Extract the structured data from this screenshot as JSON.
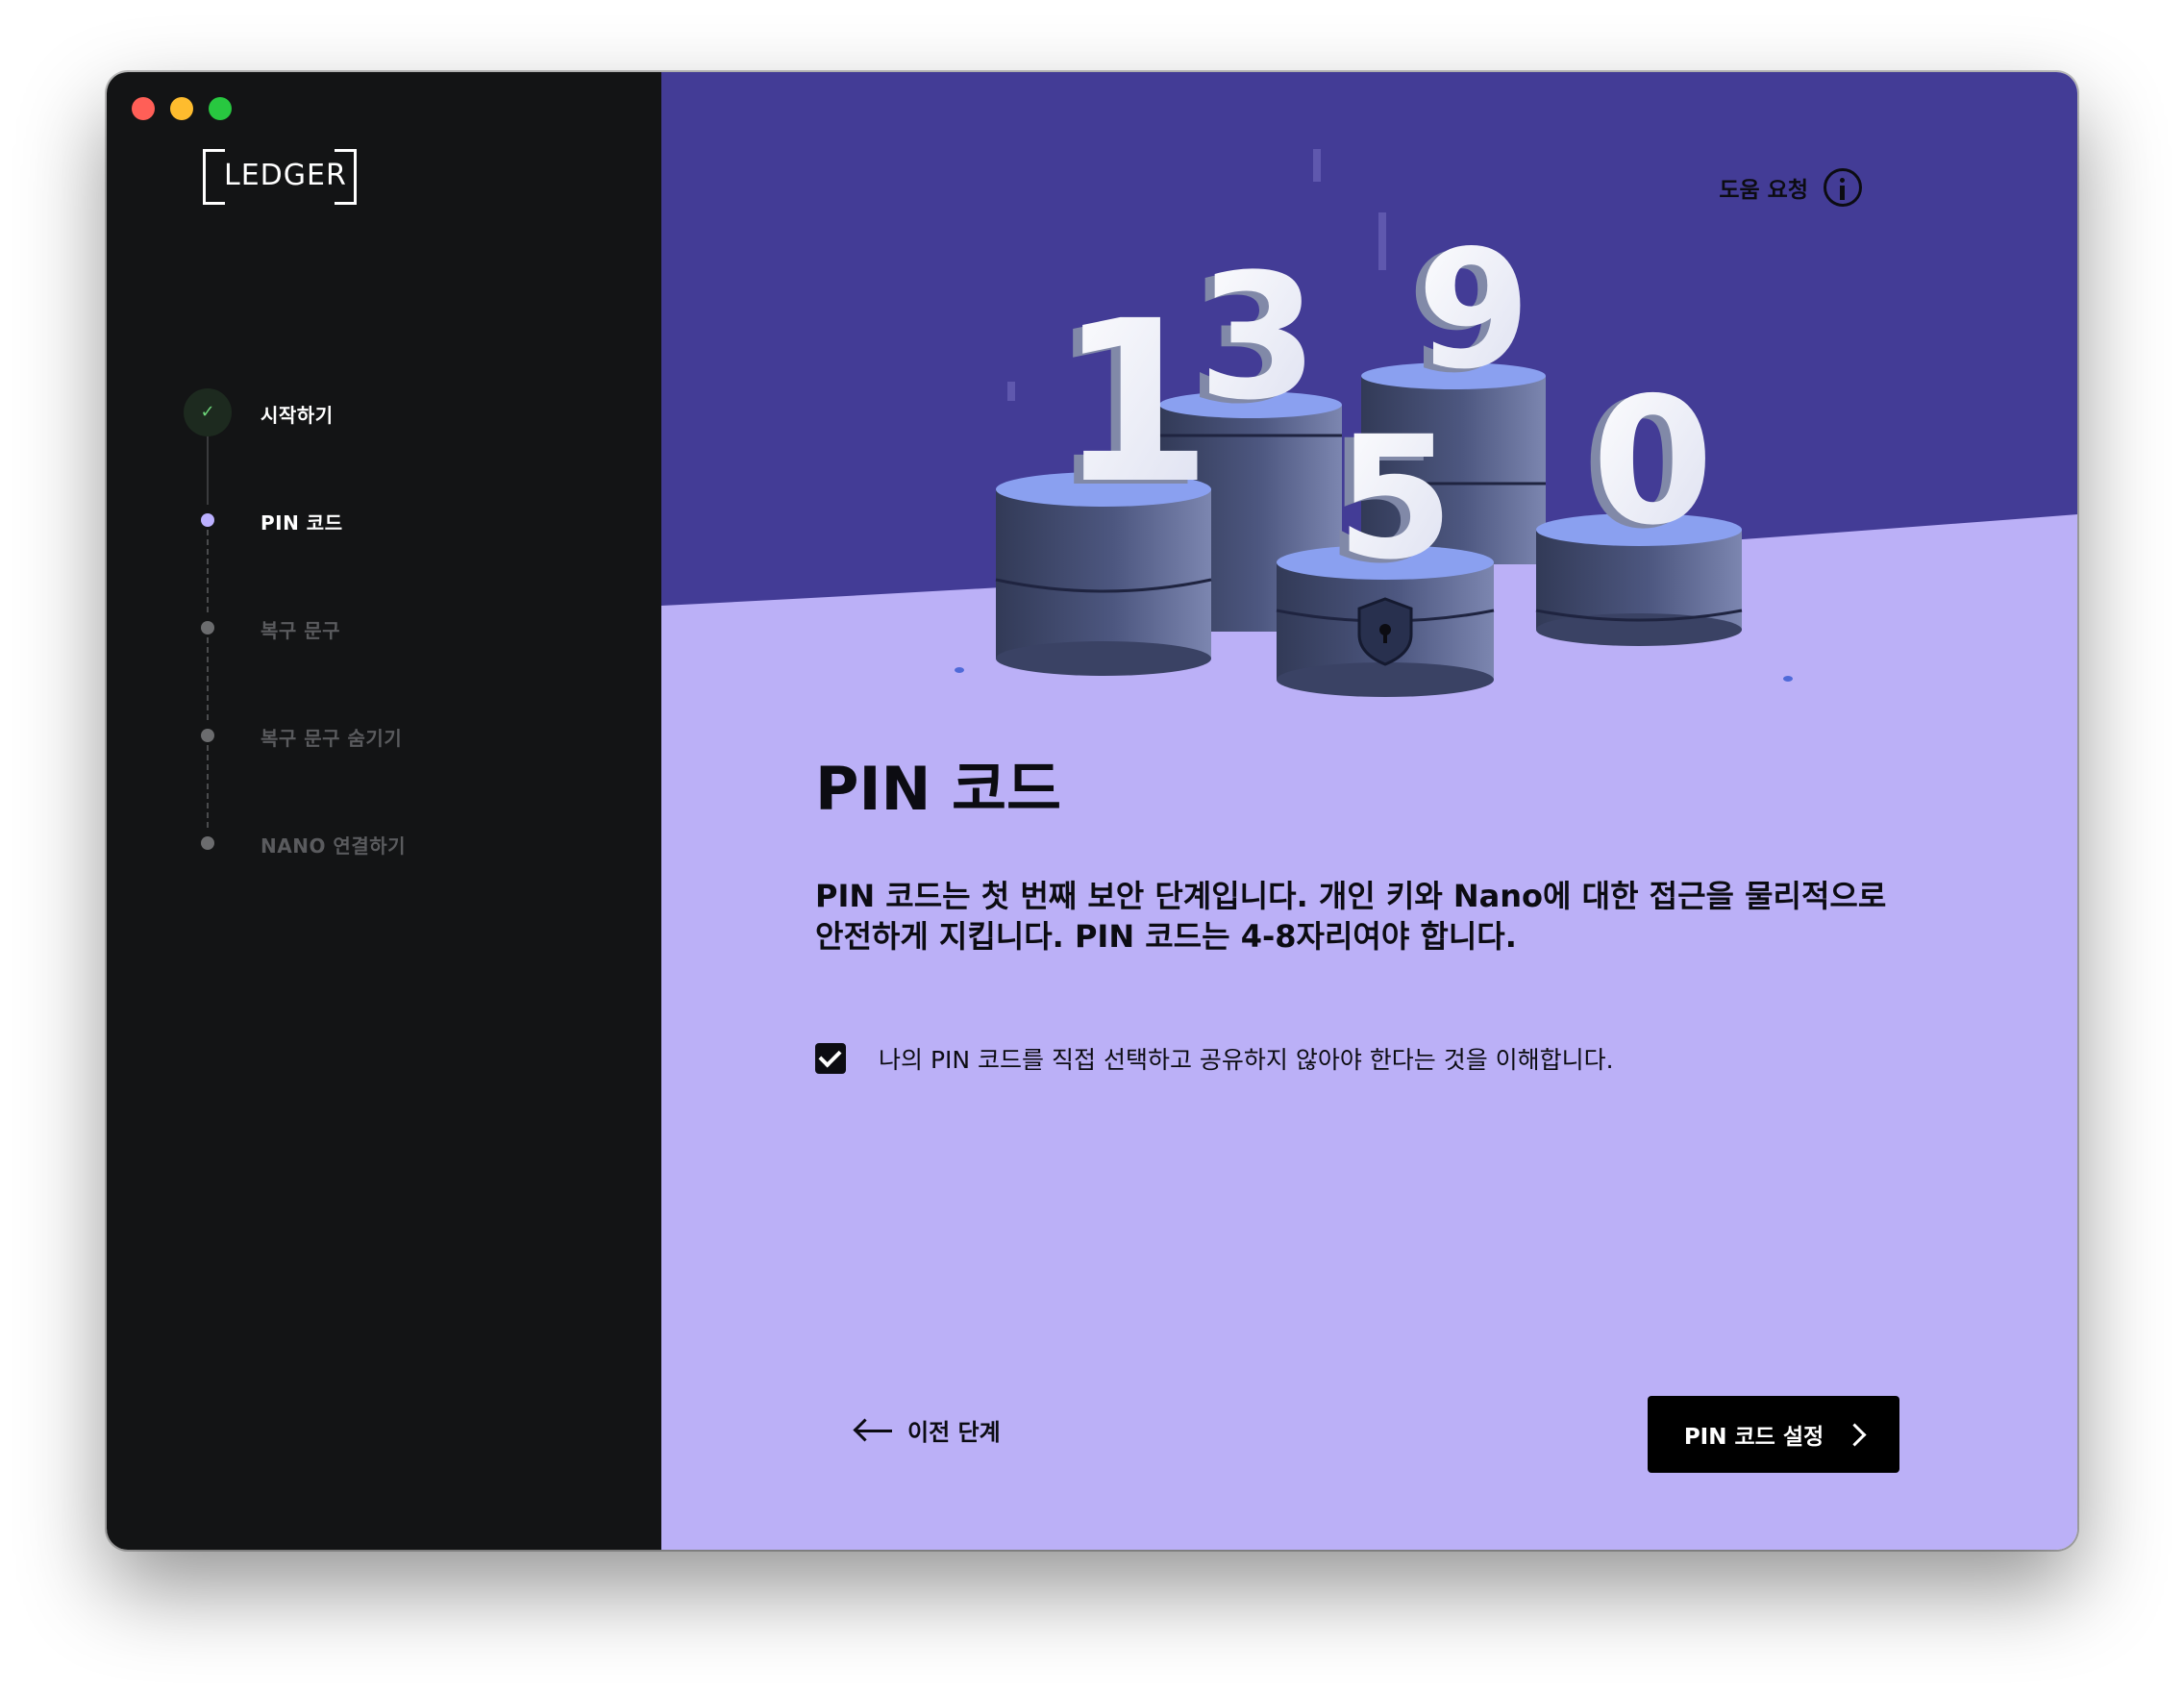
{
  "app": {
    "logo_text": "LEDGER"
  },
  "sidebar": {
    "steps": [
      {
        "label": "시작하기",
        "state": "done"
      },
      {
        "label": "PIN 코드",
        "state": "active"
      },
      {
        "label": "복구 문구",
        "state": "pending"
      },
      {
        "label": "복구 문구 숨기기",
        "state": "pending"
      },
      {
        "label": "NANO 연결하기",
        "state": "pending"
      }
    ]
  },
  "header": {
    "help_label": "도움 요청"
  },
  "hero": {
    "digits": [
      "1",
      "3",
      "9",
      "5",
      "0"
    ]
  },
  "main": {
    "title": "PIN 코드",
    "description": "PIN 코드는 첫 번째 보안 단계입니다. 개인 키와 Nano에 대한 접근을 물리적으로 안전하게 지킵니다. PIN 코드는 4-8자리여야 합니다.",
    "checkbox_label": "나의 PIN 코드를 직접 선택하고 공유하지 않아야 한다는 것을 이해합니다.",
    "checkbox_checked": true
  },
  "footer": {
    "back_label": "이전 단계",
    "primary_label": "PIN 코드 설정"
  },
  "colors": {
    "sidebar_bg": "#131415",
    "hero_top": "#433c96",
    "main_bg": "#bbb0f7",
    "accent": "#bbb0ff",
    "primary_button": "#000000"
  }
}
